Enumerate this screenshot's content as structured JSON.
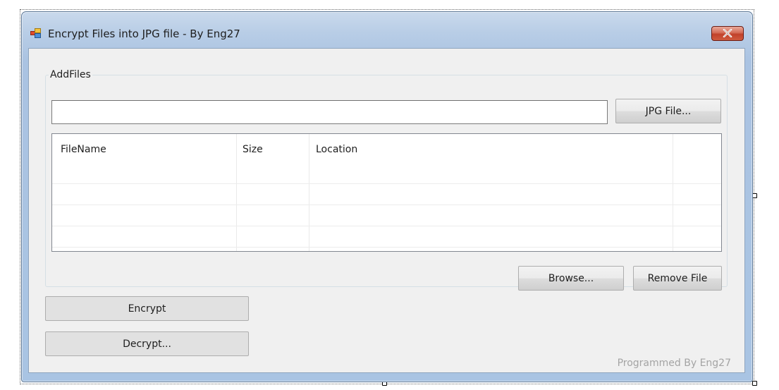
{
  "window": {
    "title": "Encrypt Files into JPG file - By Eng27",
    "close_icon": "close-x-icon",
    "app_icon": "form-icon"
  },
  "group": {
    "legend": "AddFiles",
    "path_value": "",
    "jpg_button": "JPG File...",
    "browse_button": "Browse...",
    "remove_button": "Remove File"
  },
  "listview": {
    "columns": [
      "FileName",
      "Size",
      "Location"
    ],
    "rows": []
  },
  "actions": {
    "encrypt_button": "Encrypt",
    "decrypt_button": "Decrypt..."
  },
  "footer": {
    "credit": "Programmed By Eng27"
  },
  "colors": {
    "close_button": "#c9462d",
    "footer_text": "#a4a4a4"
  }
}
